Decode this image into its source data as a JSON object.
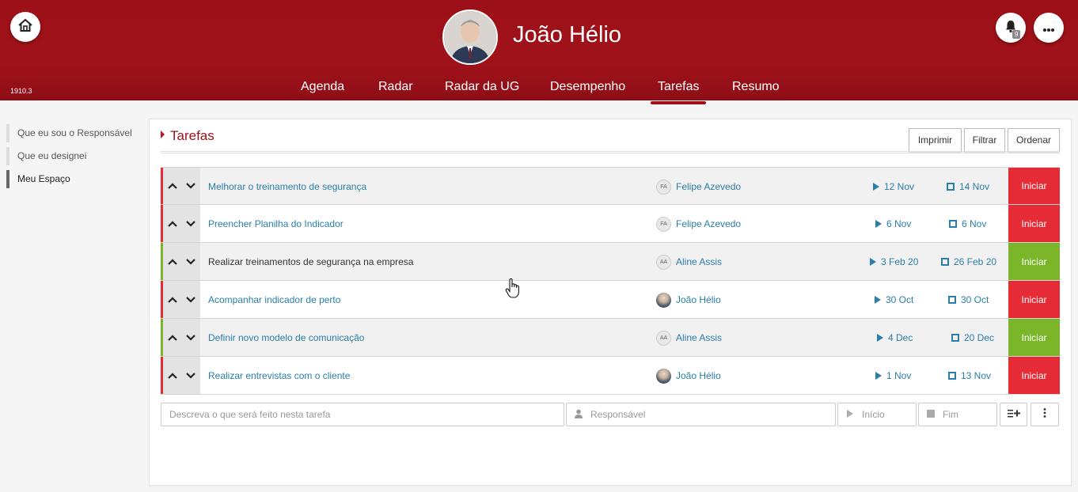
{
  "header": {
    "version": "1910.3",
    "user_name": "João Hélio",
    "notifications_count": "9",
    "home_icon": "home-icon",
    "bell_icon": "bell-icon",
    "more_icon": "more-horizontal-icon",
    "brand_color": "#a0121a"
  },
  "nav": {
    "items": [
      {
        "label": "Agenda"
      },
      {
        "label": "Radar"
      },
      {
        "label": "Radar da UG"
      },
      {
        "label": "Desempenho"
      },
      {
        "label": "Tarefas",
        "active": true
      },
      {
        "label": "Resumo"
      }
    ]
  },
  "sidebar": {
    "items": [
      {
        "label": "Que eu sou o Responsável"
      },
      {
        "label": "Que eu designei"
      },
      {
        "label": "Meu Espaço",
        "active": true
      }
    ]
  },
  "panel": {
    "title": "Tarefas",
    "buttons": {
      "print": "Imprimir",
      "filter": "Filtrar",
      "sort": "Ordenar"
    }
  },
  "tasks": [
    {
      "title": "Melhorar o treinamento de segurança",
      "responsible": "Felipe Azevedo",
      "initials": "FA",
      "start": "12 Nov",
      "end": "14 Nov",
      "action": "Iniciar",
      "status_color": "#e52b35"
    },
    {
      "title": "Preencher Planilha do Indicador",
      "responsible": "Felipe Azevedo",
      "initials": "FA",
      "start": "6 Nov",
      "end": "6 Nov",
      "action": "Iniciar",
      "status_color": "#e52b35"
    },
    {
      "title": "Realizar treinamentos de segurança na empresa",
      "responsible": "Aline Assis",
      "initials": "AA",
      "start": "3 Feb 20",
      "end": "26 Feb 20",
      "action": "Iniciar",
      "status_color": "#7bb52a"
    },
    {
      "title": "Acompanhar indicador de perto",
      "responsible": "João Hélio",
      "initials": "",
      "start": "30 Oct",
      "end": "30 Oct",
      "action": "Iniciar",
      "status_color": "#e52b35"
    },
    {
      "title": "Definir novo modelo de comunicação",
      "responsible": "Aline Assis",
      "initials": "AA",
      "start": "4 Dec",
      "end": "20 Dec",
      "action": "Iniciar",
      "status_color": "#7bb52a"
    },
    {
      "title": "Realizar entrevistas com o cliente",
      "responsible": "João Hélio",
      "initials": "",
      "start": "1 Nov",
      "end": "13 Nov",
      "action": "Iniciar",
      "status_color": "#e52b35"
    }
  ],
  "new_task": {
    "description_placeholder": "Descreva o que será feito nesta tarefa",
    "responsible_placeholder": "Responsável",
    "start_placeholder": "Início",
    "end_placeholder": "Fim"
  }
}
